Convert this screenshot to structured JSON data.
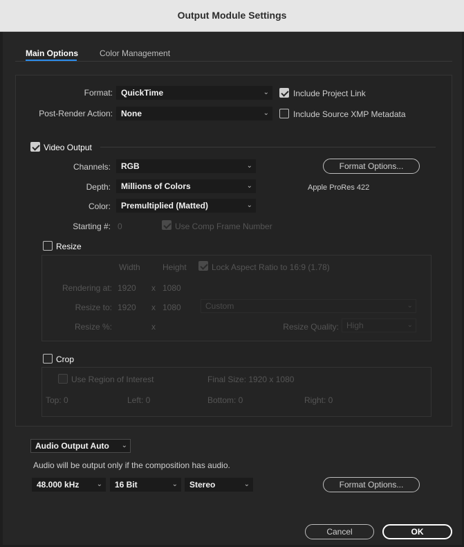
{
  "window": {
    "title": "Output Module Settings"
  },
  "tabs": [
    {
      "label": "Main Options",
      "active": true
    },
    {
      "label": "Color Management",
      "active": false
    }
  ],
  "format": {
    "label": "Format:",
    "value": "QuickTime"
  },
  "post_render": {
    "label": "Post-Render Action:",
    "value": "None"
  },
  "include_project_link": {
    "label": "Include Project Link",
    "checked": true
  },
  "include_xmp": {
    "label": "Include Source XMP Metadata",
    "checked": false
  },
  "video_output": {
    "label": "Video Output",
    "checked": true,
    "channels": {
      "label": "Channels:",
      "value": "RGB"
    },
    "depth": {
      "label": "Depth:",
      "value": "Millions of Colors"
    },
    "color": {
      "label": "Color:",
      "value": "Premultiplied (Matted)"
    },
    "starting": {
      "label": "Starting #:",
      "value": "0"
    },
    "use_comp_frame": {
      "label": "Use Comp Frame Number",
      "checked": true
    },
    "format_options_label": "Format Options...",
    "codec": "Apple ProRes 422"
  },
  "resize": {
    "label": "Resize",
    "checked": false,
    "width_label": "Width",
    "height_label": "Height",
    "lock_aspect": {
      "label": "Lock Aspect Ratio to 16:9 (1.78)",
      "checked": true
    },
    "rendering_at": {
      "label": "Rendering at:",
      "width": "1920",
      "height": "1080"
    },
    "resize_to": {
      "label": "Resize to:",
      "width": "1920",
      "height": "1080",
      "preset": "Custom"
    },
    "resize_pct": {
      "label": "Resize %:"
    },
    "times": "x",
    "quality": {
      "label": "Resize Quality:",
      "value": "High"
    }
  },
  "crop": {
    "label": "Crop",
    "checked": false,
    "roi": {
      "label": "Use Region of Interest",
      "checked": false
    },
    "final_size": "Final Size: 1920 x 1080",
    "top": "Top:  0",
    "left": "Left:  0",
    "bottom": "Bottom:  0",
    "right": "Right:  0"
  },
  "audio": {
    "mode": "Audio Output Auto",
    "note": "Audio will be output only if the composition has audio.",
    "rate": "48.000 kHz",
    "bits": "16 Bit",
    "channels": "Stereo",
    "format_options_label": "Format Options..."
  },
  "buttons": {
    "cancel": "Cancel",
    "ok": "OK"
  },
  "colors": {
    "accent": "#2d8ceb",
    "background": "#262626",
    "titlebar": "#e6e6e6"
  }
}
